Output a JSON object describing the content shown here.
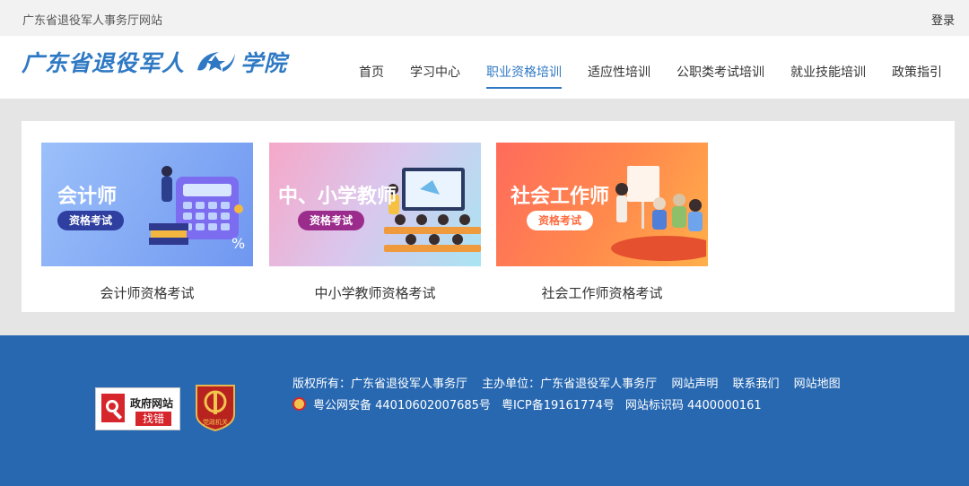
{
  "topbar": {
    "site_name": "广东省退役军人事务厅网站",
    "login": "登录"
  },
  "header": {
    "logo_text_left": "广东省退役军人",
    "logo_text_right": "学院",
    "nav": [
      "首页",
      "学习中心",
      "职业资格培训",
      "适应性培训",
      "公职类考试培训",
      "就业技能培训",
      "政策指引"
    ],
    "active_nav": "职业资格培训"
  },
  "cards": [
    {
      "title": "会计师",
      "pill": "资格考试",
      "caption": "会计师资格考试",
      "colors": [
        "#8fb4f7",
        "#6f97f0"
      ]
    },
    {
      "title": "中、小学教师",
      "pill": "资格考试",
      "caption": "中小学教师资格考试",
      "colors": [
        "#f6a8c8",
        "#a9e4f2"
      ]
    },
    {
      "title": "社会工作师",
      "pill": "资格考试",
      "caption": "社会工作师资格考试",
      "colors": [
        "#ff7a5c",
        "#ffb04a"
      ]
    }
  ],
  "footer": {
    "gov_badge_line1": "政府网站",
    "gov_badge_line2": "找错",
    "party_badge": "党政机关",
    "copyright": "版权所有：广东省退役军人事务厅",
    "host": "主办单位：广东省退役军人事务厅",
    "links": [
      "网站声明",
      "联系我们",
      "网站地图"
    ],
    "police": "粤公网安备 44010602007685号",
    "icp": "粤ICP备19161774号",
    "site_code": "网站标识码 4400000161"
  }
}
